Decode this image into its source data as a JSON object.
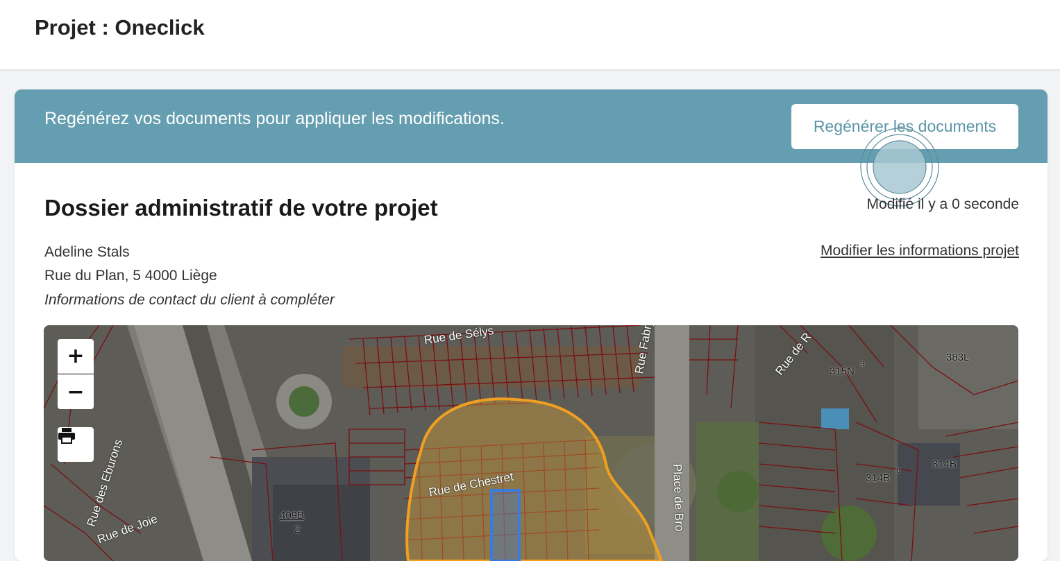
{
  "header": {
    "title": "Projet : Oneclick"
  },
  "banner": {
    "message": "Regénérez vos documents pour appliquer les modifications.",
    "button_label": "Regénérer les documents"
  },
  "dossier": {
    "title": "Dossier administratif de votre projet",
    "modified": "Modifié il y a 0 seconde",
    "edit_link": "Modifier les informations projet",
    "client_name": "Adeline Stals",
    "address": "Rue du Plan, 5 4000 Liège",
    "contact_note": "Informations de contact du client à compléter"
  },
  "map": {
    "zoom_in_label": "+",
    "zoom_out_label": "−",
    "print_icon": "printer-icon",
    "streets": [
      "Rue de Sélys",
      "Rue de Chestret",
      "Rue des Eburons",
      "Rue de Joie",
      "Rue Fabry",
      "Place de Bro",
      "Rue de R"
    ],
    "parcels": [
      "315N",
      "9",
      "383L",
      "314B",
      "6",
      "314B",
      "409B",
      "2"
    ],
    "colors": {
      "parcel_lines": "#7a1010",
      "buffer_zone": "#f0a020",
      "selected_parcel": "#3a7be0"
    }
  },
  "colors": {
    "banner": "#659eb0",
    "button_text": "#5b95a7",
    "page_bg": "#f2f3f5"
  }
}
